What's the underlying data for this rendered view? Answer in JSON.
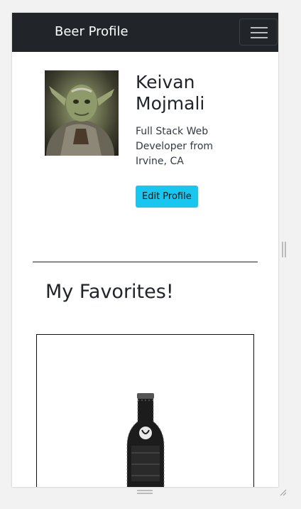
{
  "navbar": {
    "brand": "Beer Profile",
    "toggler_icon": "hamburger-menu-icon",
    "background": "#212529"
  },
  "profile": {
    "name": "Keivan Mojmali",
    "bio": "Full Stack Web Developer from Irvine, CA",
    "edit_button": "Edit Profile",
    "edit_button_color": "#17c7f0"
  },
  "favorites": {
    "title": "My Favorites!",
    "card_image": "beer-bottle-image"
  }
}
